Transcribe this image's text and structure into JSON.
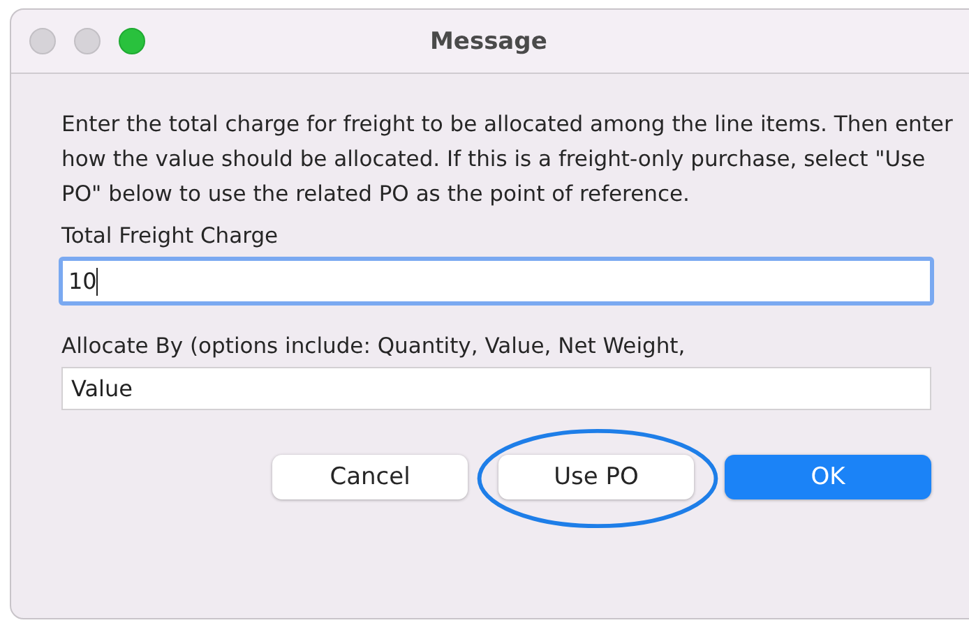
{
  "window": {
    "title": "Message",
    "lights": [
      {
        "kind": "close",
        "active": false
      },
      {
        "kind": "minimize",
        "active": false
      },
      {
        "kind": "zoom",
        "active": true
      }
    ]
  },
  "message": "Enter the total charge for freight to be allocated among the line items. Then enter how the value should be allocated. If this is a freight-only purchase, select \"Use PO\" below to use the related PO as the point of reference.",
  "fields": [
    {
      "label": "Total Freight Charge",
      "value": "10",
      "focused": true
    },
    {
      "label": "Allocate By (options include: Quantity, Value, Net Weight,",
      "value": "Value",
      "focused": false
    }
  ],
  "buttons": [
    {
      "label": "Cancel",
      "default": false,
      "circled": false
    },
    {
      "label": "Use PO",
      "default": false,
      "circled": true
    },
    {
      "label": "OK",
      "default": true,
      "circled": false
    }
  ]
}
